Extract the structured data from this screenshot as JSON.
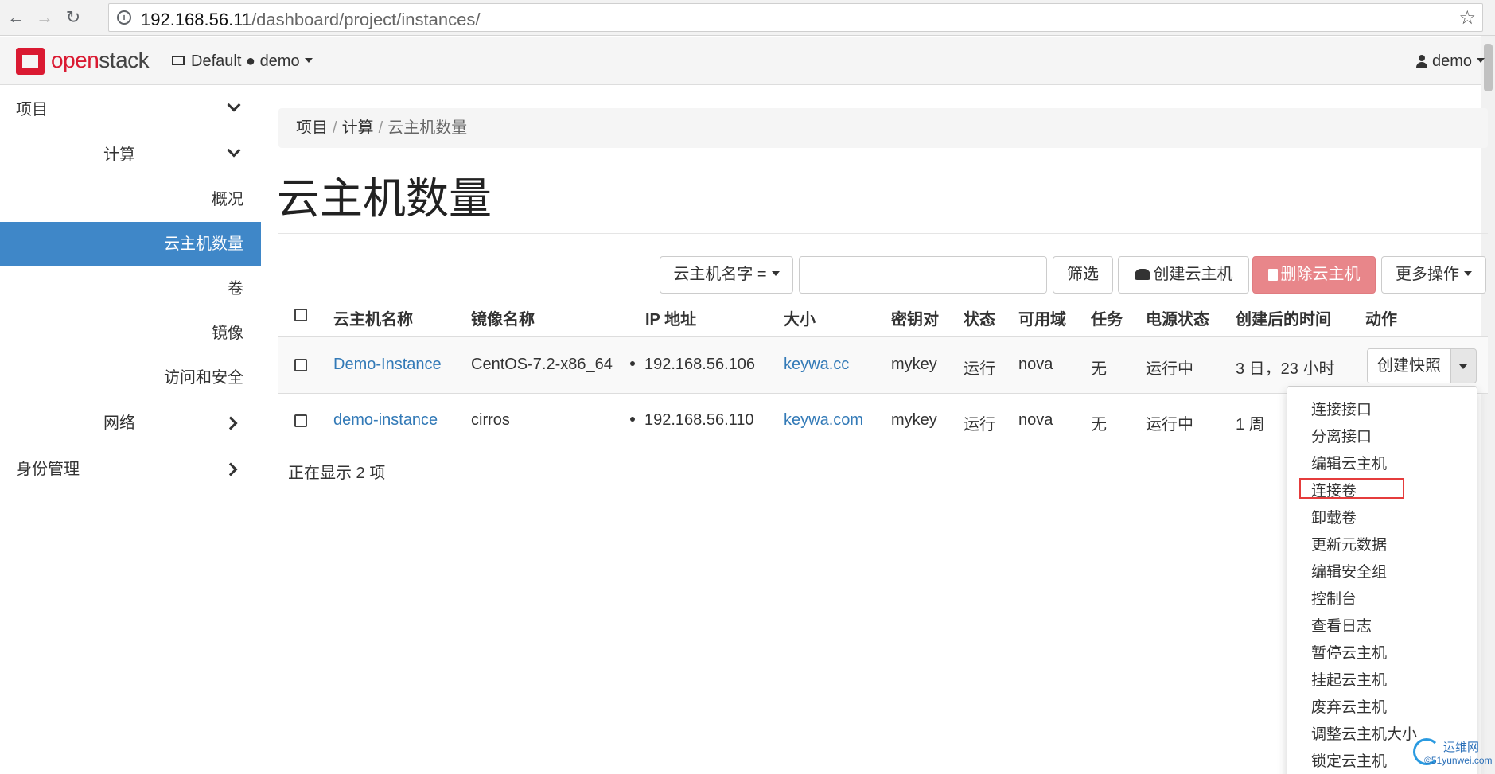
{
  "browser": {
    "back_icon": "←",
    "forward_icon": "→",
    "reload_icon": "↻",
    "url_host": "192.168.56.11",
    "url_path": "/dashboard/project/instances/",
    "star_icon": "☆"
  },
  "header": {
    "logo_open": "open",
    "logo_stack": "stack",
    "project_switcher": "Default ● demo",
    "user": "demo"
  },
  "sidebar": {
    "items": [
      {
        "label": "项目"
      },
      {
        "label": "计算"
      },
      {
        "label": "概况"
      },
      {
        "label": "云主机数量"
      },
      {
        "label": "卷"
      },
      {
        "label": "镜像"
      },
      {
        "label": "访问和安全"
      },
      {
        "label": "网络"
      },
      {
        "label": "身份管理"
      }
    ]
  },
  "breadcrumb": {
    "items": [
      "项目",
      "计算"
    ],
    "current": "云主机数量",
    "sep": "/"
  },
  "page": {
    "title": "云主机数量"
  },
  "toolbar": {
    "filter_select": "云主机名字 =",
    "filter_input_value": "",
    "filter_button": "筛选",
    "create_button": "创建云主机",
    "delete_button": "删除云主机",
    "more_button": "更多操作"
  },
  "table": {
    "headers": [
      "云主机名称",
      "镜像名称",
      "IP 地址",
      "大小",
      "密钥对",
      "状态",
      "可用域",
      "任务",
      "电源状态",
      "创建后的时间",
      "动作"
    ],
    "rows": [
      {
        "name": "Demo-Instance",
        "image": "CentOS-7.2-x86_64",
        "ip": "192.168.56.106",
        "size": "keywa.cc",
        "keypair": "mykey",
        "status": "运行",
        "zone": "nova",
        "task": "无",
        "power": "运行中",
        "age": "3 日，23 小时",
        "action": "创建快照"
      },
      {
        "name": "demo-instance",
        "image": "cirros",
        "ip": "192.168.56.110",
        "size": "keywa.com",
        "keypair": "mykey",
        "status": "运行",
        "zone": "nova",
        "task": "无",
        "power": "运行中",
        "age": "1 周",
        "action": ""
      }
    ],
    "footer": "正在显示 2 项"
  },
  "dropdown": {
    "items": [
      "连接接口",
      "分离接口",
      "编辑云主机",
      "连接卷",
      "卸载卷",
      "更新元数据",
      "编辑安全组",
      "控制台",
      "查看日志",
      "暂停云主机",
      "挂起云主机",
      "废弃云主机",
      "调整云主机大小",
      "锁定云主机"
    ],
    "highlighted_color": "#e53c3c"
  },
  "watermark": {
    "line1": "运维网",
    "line2": "©51yunwei.com"
  },
  "colors": {
    "accent": "#3f87c8",
    "danger": "#e8868a",
    "link": "#337ab7",
    "brand": "#da1a32"
  }
}
